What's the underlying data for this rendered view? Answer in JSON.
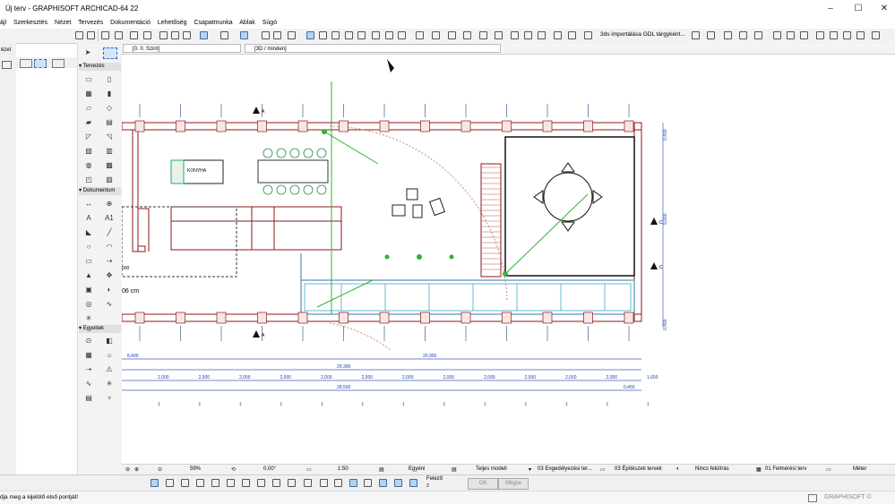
{
  "window": {
    "title": "Új terv - GRAPHISOFT ARCHICAD-64 22",
    "minimize": "–",
    "maximize": "☐",
    "close": "✕"
  },
  "menu": [
    "ájl",
    "Szerkesztés",
    "Nézet",
    "Tervezés",
    "Dokumentáció",
    "Lehetőség",
    "Csapatmunka",
    "Ablak",
    "Súgó"
  ],
  "toolbar": {
    "import_label": "3ds importálása GDL tárgyként..."
  },
  "tabs": {
    "floor": "[0. 0. Szint]",
    "view3d": "[3D / minden]"
  },
  "left_panel": {
    "label": "ézet"
  },
  "toolbox": {
    "sections": {
      "design": "Tervezés",
      "document": "Dokumentum",
      "other": "Egyebek"
    },
    "design_tools": [
      "▭",
      "▯",
      "▦",
      "▮",
      "▱",
      "◇",
      "▰",
      "▤",
      "◸",
      "◹",
      "▧",
      "▥",
      "◍",
      "▩",
      "◰",
      "▨"
    ],
    "document_tools": [
      "↔",
      "⊕",
      "A",
      "A1",
      "◣",
      "╱",
      "○",
      "◠",
      "▭",
      "⇢",
      "▲",
      "✥",
      "▣",
      "◐",
      "◎",
      "∿",
      "✳"
    ],
    "other_tools": [
      "⊙",
      "◧",
      "▦",
      "☼",
      "⇢",
      "⚠",
      "∿",
      "✳",
      "▤",
      "♆"
    ]
  },
  "drawing": {
    "dims_top": [
      "2,000",
      "2,000",
      "2,000",
      "2,000",
      "2,000",
      "2,000",
      "2,000",
      "2,000",
      "2,000",
      "2,000",
      "2,000",
      "2,000",
      "1,650"
    ],
    "dim_total_a": "8,400",
    "dim_total_b": "20,900",
    "dim_total_c": "29,300",
    "dim_total_d": "28,500",
    "dim_total_e": "0,450",
    "right_dims": [
      "0,400",
      "9,000",
      "0,400"
    ],
    "section_markers": [
      "A",
      "A",
      "C",
      "C"
    ],
    "note": "06 cm",
    "bed_label": "KONYHA",
    "left_dim": "000"
  },
  "statusbar": {
    "zoom": "59%",
    "angle": "0,00°",
    "scale": "1:50",
    "layer": "Egyéni",
    "model": "Teljes modell",
    "approval": "03 Engedélyezési ter...",
    "construction": "03 Építészeti tervek",
    "override": "Nincs felülírás",
    "survey": "01 Felmérési terv",
    "units": "Méter"
  },
  "infobar": {
    "felezo": "Felező",
    "felezo_num": "2",
    "ok": "OK",
    "cancel": "Mégse"
  },
  "bottom": {
    "prompt": "dja meg a kijelölő első pontját!",
    "brand": "GRAPHISOFT ©"
  }
}
